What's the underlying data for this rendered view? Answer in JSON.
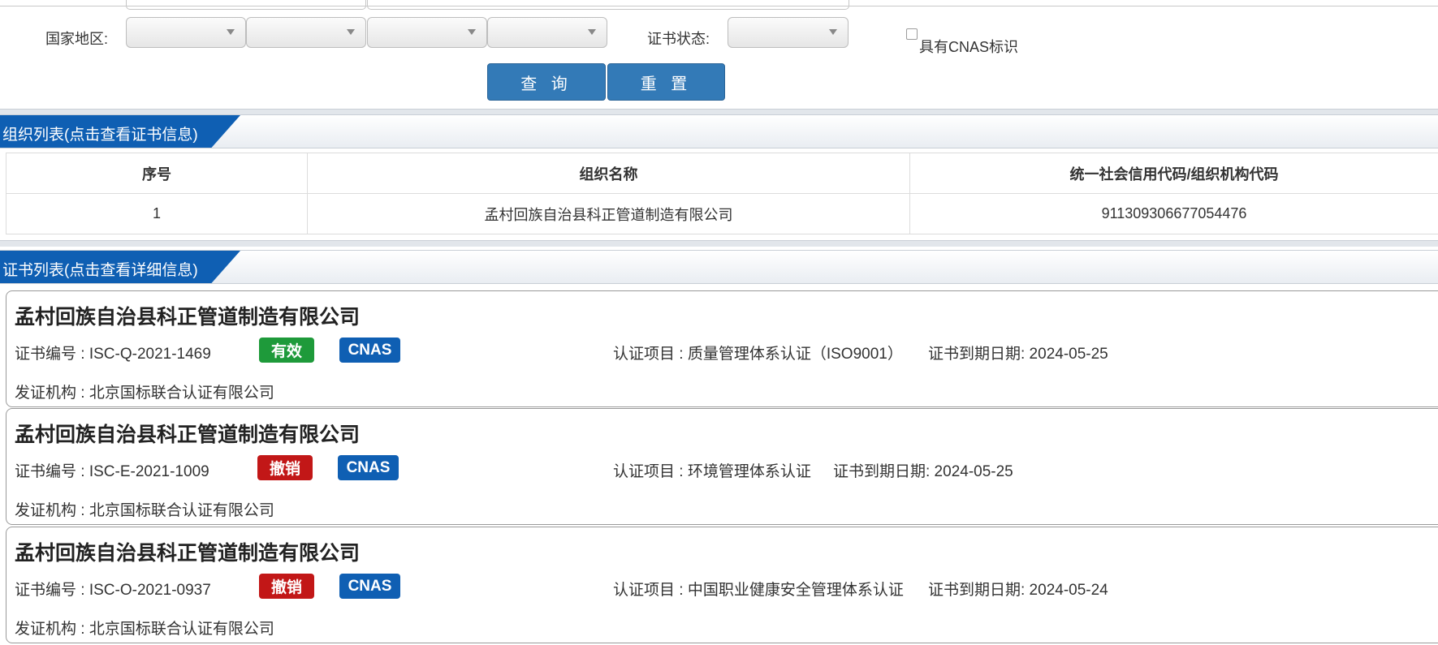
{
  "form": {
    "region_label": "国家地区:",
    "status_label": "证书状态:",
    "cnas_checkbox_label": "具有CNAS标识",
    "query_button": "查 询",
    "reset_button": "重 置"
  },
  "org_section": {
    "title": "组织列表(点击查看证书信息)",
    "columns": [
      "序号",
      "组织名称",
      "统一社会信用代码/组织机构代码"
    ],
    "rows": [
      {
        "index": "1",
        "name": "孟村回族自治县科正管道制造有限公司",
        "code": "911309306677054476"
      }
    ]
  },
  "cert_section": {
    "title": "证书列表(点击查看详细信息)",
    "certs": [
      {
        "company": "孟村回族自治县科正管道制造有限公司",
        "cert_no": "证书编号 : ISC-Q-2021-1469",
        "status": "有效",
        "status_color": "#1e9a3a",
        "cnas": "CNAS",
        "project": "认证项目 : 质量管理体系认证（ISO9001）",
        "expiry": "证书到期日期: 2024-05-25",
        "issuer": "发证机构 : 北京国标联合认证有限公司"
      },
      {
        "company": "孟村回族自治县科正管道制造有限公司",
        "cert_no": "证书编号 : ISC-E-2021-1009",
        "status": "撤销",
        "status_color": "#c21717",
        "cnas": "CNAS",
        "project": "认证项目 : 环境管理体系认证",
        "expiry": "证书到期日期: 2024-05-25",
        "issuer": "发证机构 : 北京国标联合认证有限公司"
      },
      {
        "company": "孟村回族自治县科正管道制造有限公司",
        "cert_no": "证书编号 : ISC-O-2021-0937",
        "status": "撤销",
        "status_color": "#c21717",
        "cnas": "CNAS",
        "project": "认证项目 : 中国职业健康安全管理体系认证",
        "expiry": "证书到期日期: 2024-05-24",
        "issuer": "发证机构 : 北京国标联合认证有限公司"
      }
    ]
  }
}
